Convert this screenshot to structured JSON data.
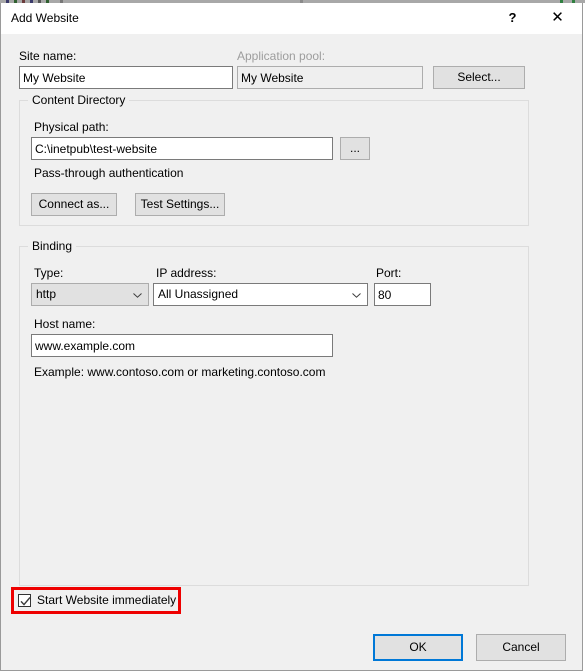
{
  "window": {
    "title": "Add Website",
    "help_icon": "question-mark-icon",
    "close_icon": "close-icon"
  },
  "site_name": {
    "label": "Site name:",
    "value": "My Website"
  },
  "application_pool": {
    "label": "Application pool:",
    "value": "My Website",
    "select_button": "Select..."
  },
  "content_directory": {
    "title": "Content Directory",
    "physical_path_label": "Physical path:",
    "physical_path_value": "C:\\inetpub\\test-website",
    "browse_button": "...",
    "auth_label": "Pass-through authentication",
    "connect_as_button": "Connect as...",
    "test_settings_button": "Test Settings..."
  },
  "binding": {
    "title": "Binding",
    "type_label": "Type:",
    "type_value": "http",
    "ip_label": "IP address:",
    "ip_value": "All Unassigned",
    "port_label": "Port:",
    "port_value": "80",
    "host_name_label": "Host name:",
    "host_name_value": "www.example.com",
    "example_text": "Example: www.contoso.com or marketing.contoso.com"
  },
  "start_immediately": {
    "label": "Start Website immediately",
    "checked": true,
    "highlight_color": "#ee0000"
  },
  "footer": {
    "ok_button": "OK",
    "cancel_button": "Cancel",
    "accent_color": "#0078d7"
  }
}
